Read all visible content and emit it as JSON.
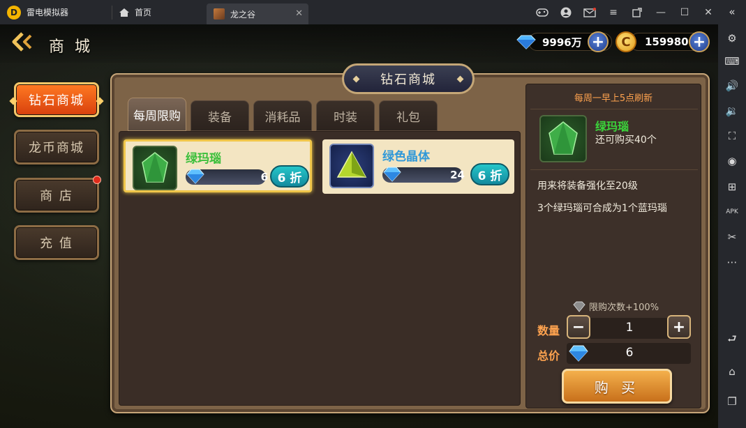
{
  "emulator": {
    "app_name": "雷电模拟器",
    "tabs": [
      {
        "label": "首页"
      },
      {
        "label": "龙之谷"
      }
    ],
    "title_icons": [
      "gamepad-icon",
      "user-icon",
      "mail-icon",
      "menu-icon",
      "restore-icon",
      "minimize-icon",
      "maximize-icon",
      "close-icon"
    ],
    "side_icons": [
      "collapse-icon",
      "settings-icon",
      "keyboard-icon",
      "volume-up-icon",
      "volume-down-icon",
      "screenshot-icon",
      "record-icon",
      "add-window-icon",
      "apk-icon",
      "scissors-icon",
      "more-icon",
      "back-icon",
      "home-icon",
      "recent-apps-icon"
    ]
  },
  "game": {
    "title": "商 城",
    "currency": {
      "diamond": "9996万",
      "gold": "159980",
      "gold_symbol": "C"
    },
    "side_menu": [
      {
        "label": "钻石商城",
        "active": true
      },
      {
        "label": "龙币商城",
        "active": false
      },
      {
        "label": "商 店",
        "active": false,
        "badge": true
      },
      {
        "label": "充 值",
        "active": false
      }
    ],
    "panel_title": "钻石商城",
    "tabs": [
      {
        "label": "每周限购",
        "active": true
      },
      {
        "label": "装备",
        "active": false
      },
      {
        "label": "消耗品",
        "active": false
      },
      {
        "label": "时装",
        "active": false
      },
      {
        "label": "礼包",
        "active": false
      }
    ],
    "items": [
      {
        "name": "绿玛瑙",
        "price": "6",
        "discount": "6 折",
        "selected": true,
        "color": "#3bbf3b"
      },
      {
        "name": "绿色晶体",
        "price": "24",
        "discount": "6 折",
        "selected": false,
        "color": "#2f98d8"
      }
    ],
    "detail": {
      "refresh": "每周一早上5点刷新",
      "name": "绿玛瑙",
      "remaining": "还可购买40个",
      "desc1": "用来将装备强化至20级",
      "desc2": "3个绿玛瑙可合成为1个蓝玛瑙",
      "limit": "限购次数+100%",
      "qty_label": "数量",
      "qty_value": "1",
      "qty_minus": "−",
      "qty_plus": "+",
      "total_label": "总价",
      "total_value": "6",
      "buy_label": "购 买"
    }
  }
}
